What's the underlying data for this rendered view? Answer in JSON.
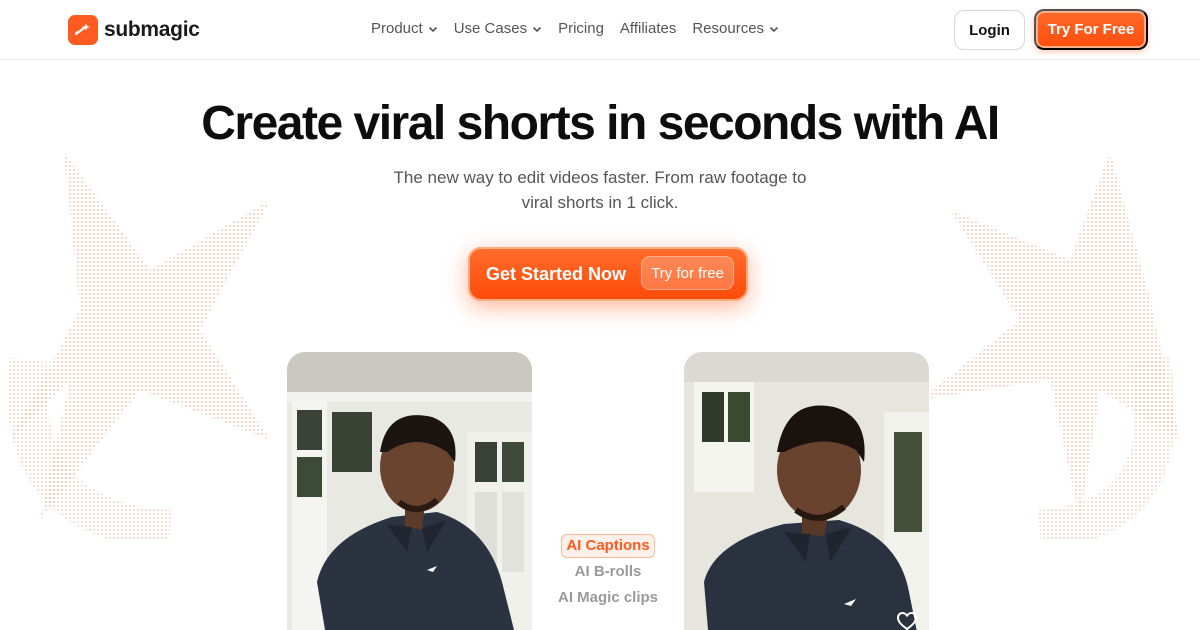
{
  "brand": {
    "name": "submagic",
    "logo_icon": "magic-wand-icon",
    "accent": "#ff5a1f"
  },
  "nav": {
    "items": [
      {
        "label": "Product",
        "dropdown": true
      },
      {
        "label": "Use Cases",
        "dropdown": true
      },
      {
        "label": "Pricing",
        "dropdown": false
      },
      {
        "label": "Affiliates",
        "dropdown": false
      },
      {
        "label": "Resources",
        "dropdown": true
      }
    ],
    "login_label": "Login",
    "try_label": "Try For Free"
  },
  "hero": {
    "title": "Create viral shorts in seconds with AI",
    "subtitle": "The new way to edit videos faster. From raw footage to viral shorts in 1 click.",
    "cta_label": "Get Started Now",
    "cta_pill": "Try for free"
  },
  "features": [
    {
      "label": "AI Captions",
      "active": true
    },
    {
      "label": "AI B-rolls",
      "active": false
    },
    {
      "label": "AI Magic clips",
      "active": false
    }
  ],
  "cards": [
    {
      "name": "video-card-before",
      "icon": "none"
    },
    {
      "name": "video-card-after",
      "icon": "heart-icon"
    }
  ]
}
